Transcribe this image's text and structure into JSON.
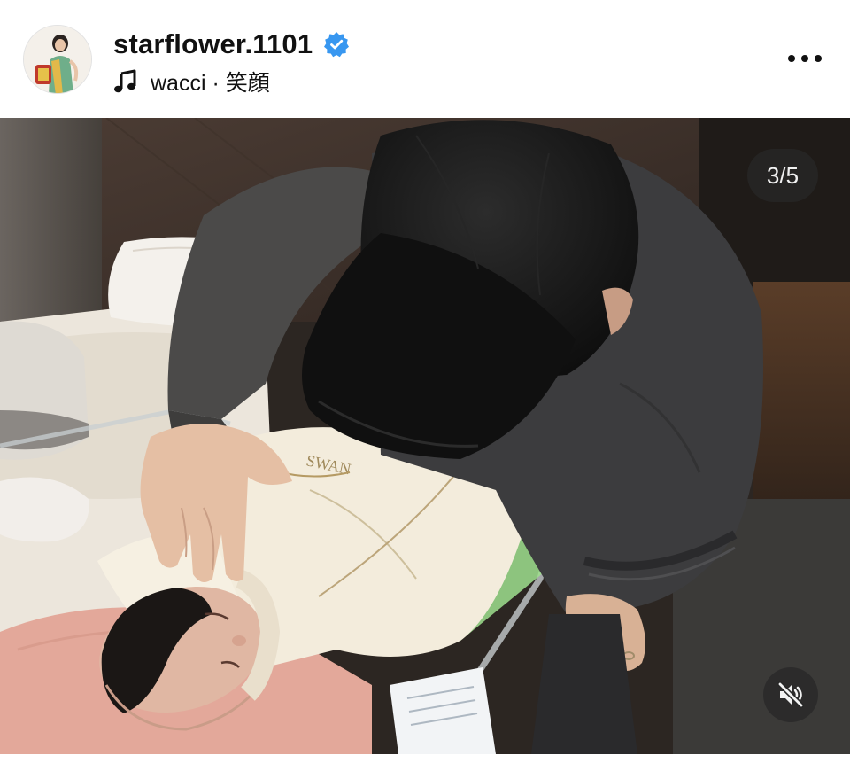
{
  "post": {
    "username": "starflower.1101",
    "verified": true,
    "music_artist": "wacci",
    "music_separator": " · ",
    "music_title": "笑顔"
  },
  "media": {
    "counter": "3/5",
    "muted": true,
    "blanket_text": "SWAN"
  },
  "icons": {
    "verified": "verified-badge-icon",
    "music": "music-note-icon",
    "more": "more-options-icon",
    "mute": "speaker-muted-icon"
  },
  "colors": {
    "verified_blue": "#3897f0",
    "text": "#111111",
    "overlay": "#282828"
  }
}
